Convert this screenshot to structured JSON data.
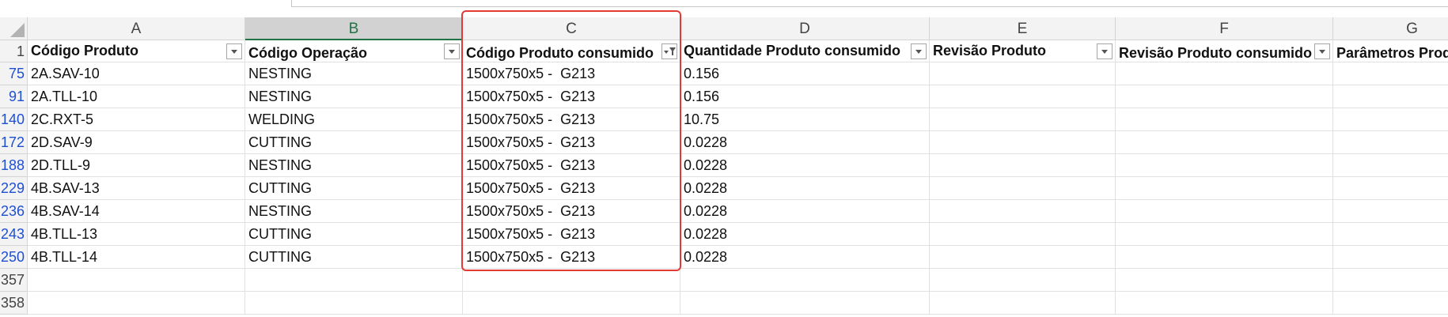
{
  "columns": [
    "A",
    "B",
    "C",
    "D",
    "E",
    "F",
    "G"
  ],
  "selected_column": "B",
  "header_row_number": "1",
  "headers": [
    "Código Produto",
    "Código Operação",
    "Código Produto consumido",
    "Quantidade Produto consumido",
    "Revisão Produto",
    "Revisão Produto consumido",
    "Parâmetros Prod"
  ],
  "rows": [
    {
      "num": "75",
      "a": "2A.SAV-10",
      "b": "NESTING",
      "c": "1500x750x5 -  G213",
      "d": "0.156"
    },
    {
      "num": "91",
      "a": "2A.TLL-10",
      "b": "NESTING",
      "c": "1500x750x5 -  G213",
      "d": "0.156"
    },
    {
      "num": "140",
      "a": "2C.RXT-5",
      "b": "WELDING",
      "c": "1500x750x5 -  G213",
      "d": "10.75"
    },
    {
      "num": "172",
      "a": "2D.SAV-9",
      "b": "CUTTING",
      "c": "1500x750x5 -  G213",
      "d": "0.0228"
    },
    {
      "num": "188",
      "a": "2D.TLL-9",
      "b": "NESTING",
      "c": "1500x750x5 -  G213",
      "d": "0.0228"
    },
    {
      "num": "229",
      "a": "4B.SAV-13",
      "b": "CUTTING",
      "c": "1500x750x5 -  G213",
      "d": "0.0228"
    },
    {
      "num": "236",
      "a": "4B.SAV-14",
      "b": "NESTING",
      "c": "1500x750x5 -  G213",
      "d": "0.0228"
    },
    {
      "num": "243",
      "a": "4B.TLL-13",
      "b": "CUTTING",
      "c": "1500x750x5 -  G213",
      "d": "0.0228"
    },
    {
      "num": "250",
      "a": "4B.TLL-14",
      "b": "CUTTING",
      "c": "1500x750x5 -  G213",
      "d": "0.0228"
    }
  ],
  "empty_rows": [
    "357",
    "358"
  ],
  "filtered_column": "C",
  "colors": {
    "highlight": "#e53935",
    "selected_column_text": "#217346",
    "filtered_row_number": "#1f4fd1"
  }
}
